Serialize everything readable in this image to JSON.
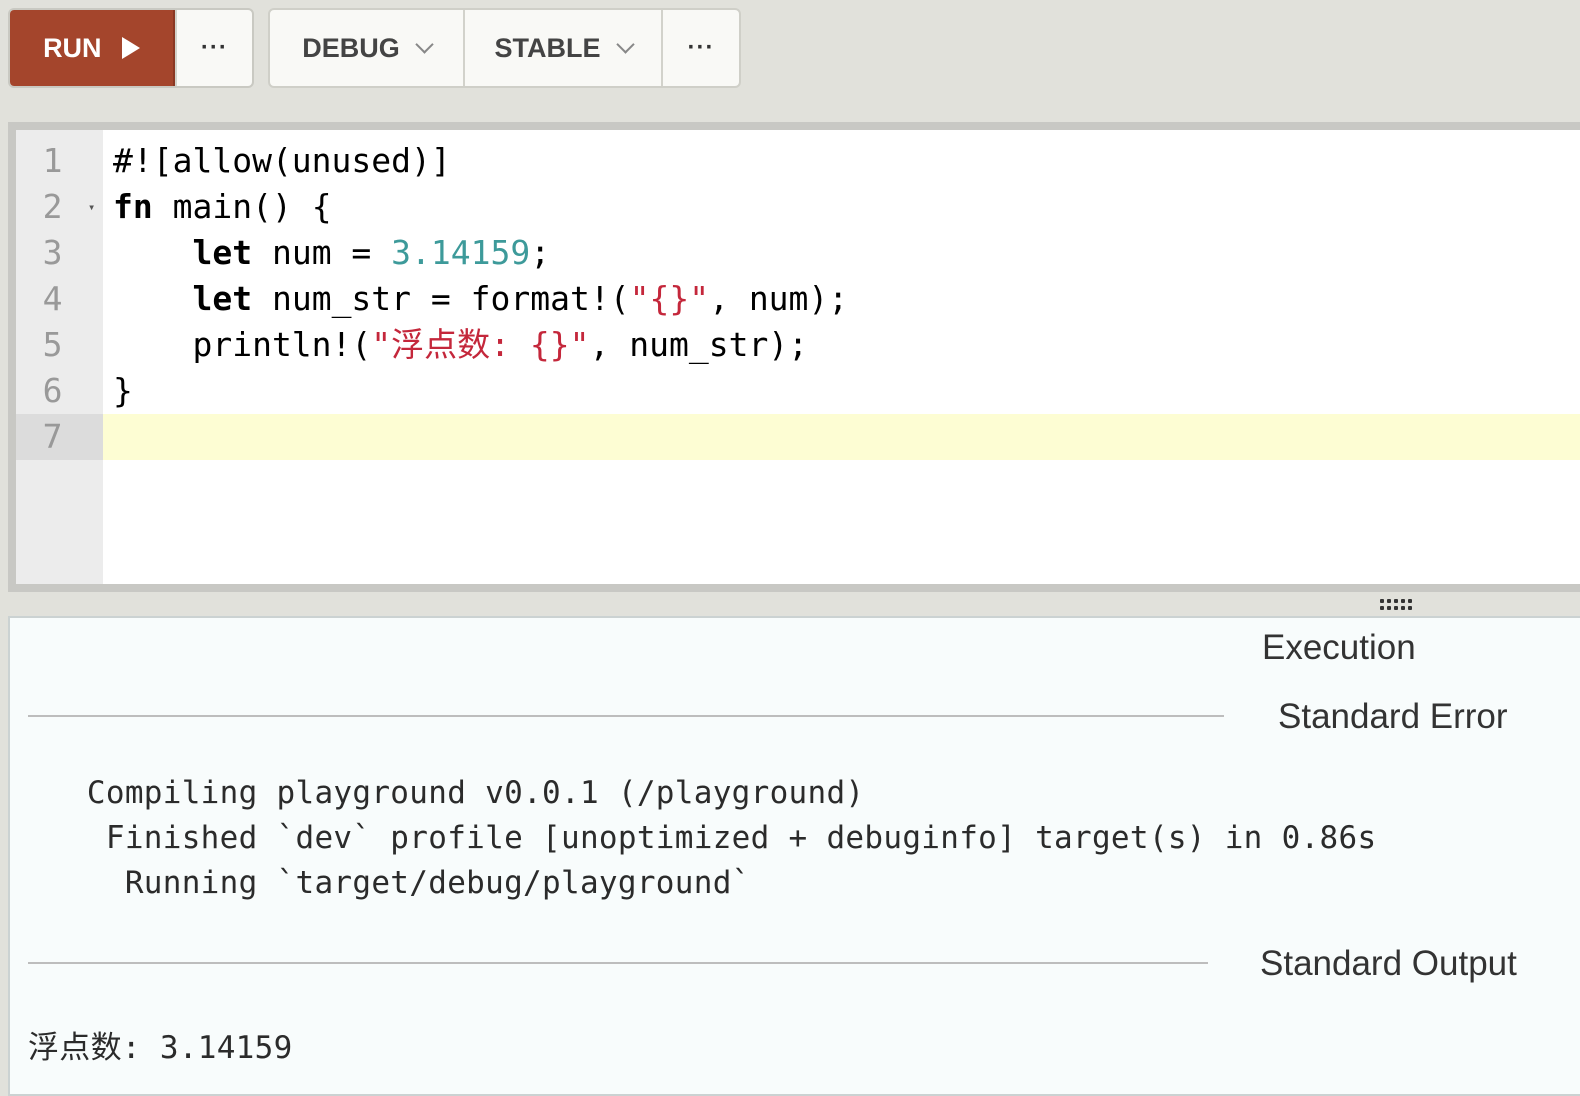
{
  "toolbar": {
    "run_label": "RUN",
    "more_label": "···",
    "mode_label": "DEBUG",
    "channel_label": "STABLE"
  },
  "editor": {
    "line_numbers": [
      "1",
      "2",
      "3",
      "4",
      "5",
      "6",
      "7"
    ],
    "lines": [
      [
        {
          "t": "#![allow(unused)]",
          "c": ""
        }
      ],
      [
        {
          "t": "fn",
          "c": "kw"
        },
        {
          "t": " main() {",
          "c": ""
        }
      ],
      [
        {
          "t": "    ",
          "c": ""
        },
        {
          "t": "let",
          "c": "kw"
        },
        {
          "t": " num = ",
          "c": ""
        },
        {
          "t": "3.14159",
          "c": "num"
        },
        {
          "t": ";",
          "c": ""
        }
      ],
      [
        {
          "t": "    ",
          "c": ""
        },
        {
          "t": "let",
          "c": "kw"
        },
        {
          "t": " num_str = format!(",
          "c": ""
        },
        {
          "t": "\"{}\"",
          "c": "str"
        },
        {
          "t": ", num);",
          "c": ""
        }
      ],
      [
        {
          "t": "    println!(",
          "c": ""
        },
        {
          "t": "\"浮点数: {}\"",
          "c": "str"
        },
        {
          "t": ", num_str);",
          "c": ""
        }
      ],
      [
        {
          "t": "}",
          "c": ""
        }
      ],
      [
        {
          "t": "",
          "c": ""
        }
      ]
    ],
    "active_line": 7
  },
  "output": {
    "execution_label": "Execution",
    "stderr_label": "Standard Error",
    "stderr_lines": [
      "   Compiling playground v0.0.1 (/playground)",
      "    Finished `dev` profile [unoptimized + debuginfo] target(s) in 0.86s",
      "     Running `target/debug/playground`"
    ],
    "stdout_label": "Standard Output",
    "stdout_text": "浮点数: 3.14159"
  },
  "colors": {
    "run_button": "#a4452c",
    "number": "#3d9a9a",
    "string": "#c4273b",
    "active_line": "#fdfdd3"
  }
}
